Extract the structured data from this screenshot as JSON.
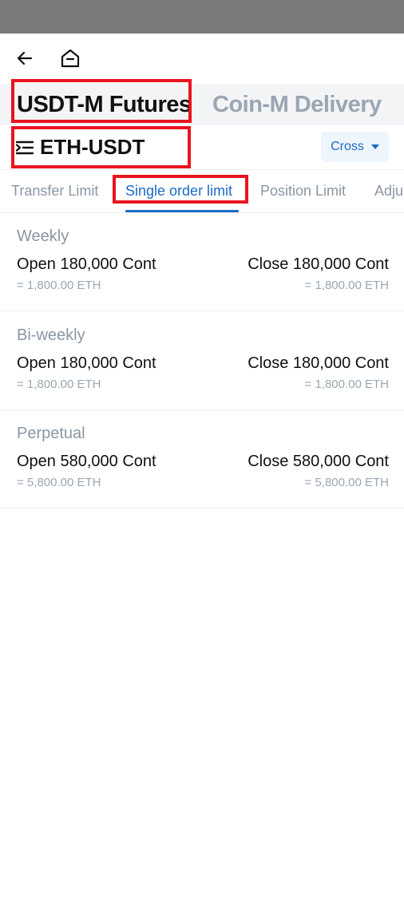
{
  "nav": {
    "back_icon": "arrow-left-icon",
    "home_icon": "home-icon"
  },
  "market_tabs": [
    {
      "label": "USDT-M Futures",
      "active": true
    },
    {
      "label": "Coin-M Delivery",
      "active": false
    }
  ],
  "symbol": {
    "icon": "list-menu-icon",
    "label": "ETH-USDT"
  },
  "margin_mode": {
    "label": "Cross",
    "icon": "caret-down-icon"
  },
  "limit_tabs": [
    {
      "label": "Transfer Limit",
      "active": false
    },
    {
      "label": "Single order limit",
      "active": true
    },
    {
      "label": "Position Limit",
      "active": false
    },
    {
      "label": "Adju",
      "active": false
    }
  ],
  "limits": [
    {
      "title": "Weekly",
      "open": "Open 180,000 Cont",
      "open_sub": "= 1,800.00 ETH",
      "close": "Close 180,000 Cont",
      "close_sub": "= 1,800.00 ETH"
    },
    {
      "title": "Bi-weekly",
      "open": "Open 180,000 Cont",
      "open_sub": "= 1,800.00 ETH",
      "close": "Close 180,000 Cont",
      "close_sub": "= 1,800.00 ETH"
    },
    {
      "title": "Perpetual",
      "open": "Open 580,000 Cont",
      "open_sub": "= 5,800.00 ETH",
      "close": "Close 580,000 Cont",
      "close_sub": "= 5,800.00 ETH"
    }
  ],
  "colors": {
    "accent": "#1a6bc4",
    "highlight": "#e8141e",
    "muted_text": "#8a96a3",
    "status_bar": "#7a7a7a"
  }
}
